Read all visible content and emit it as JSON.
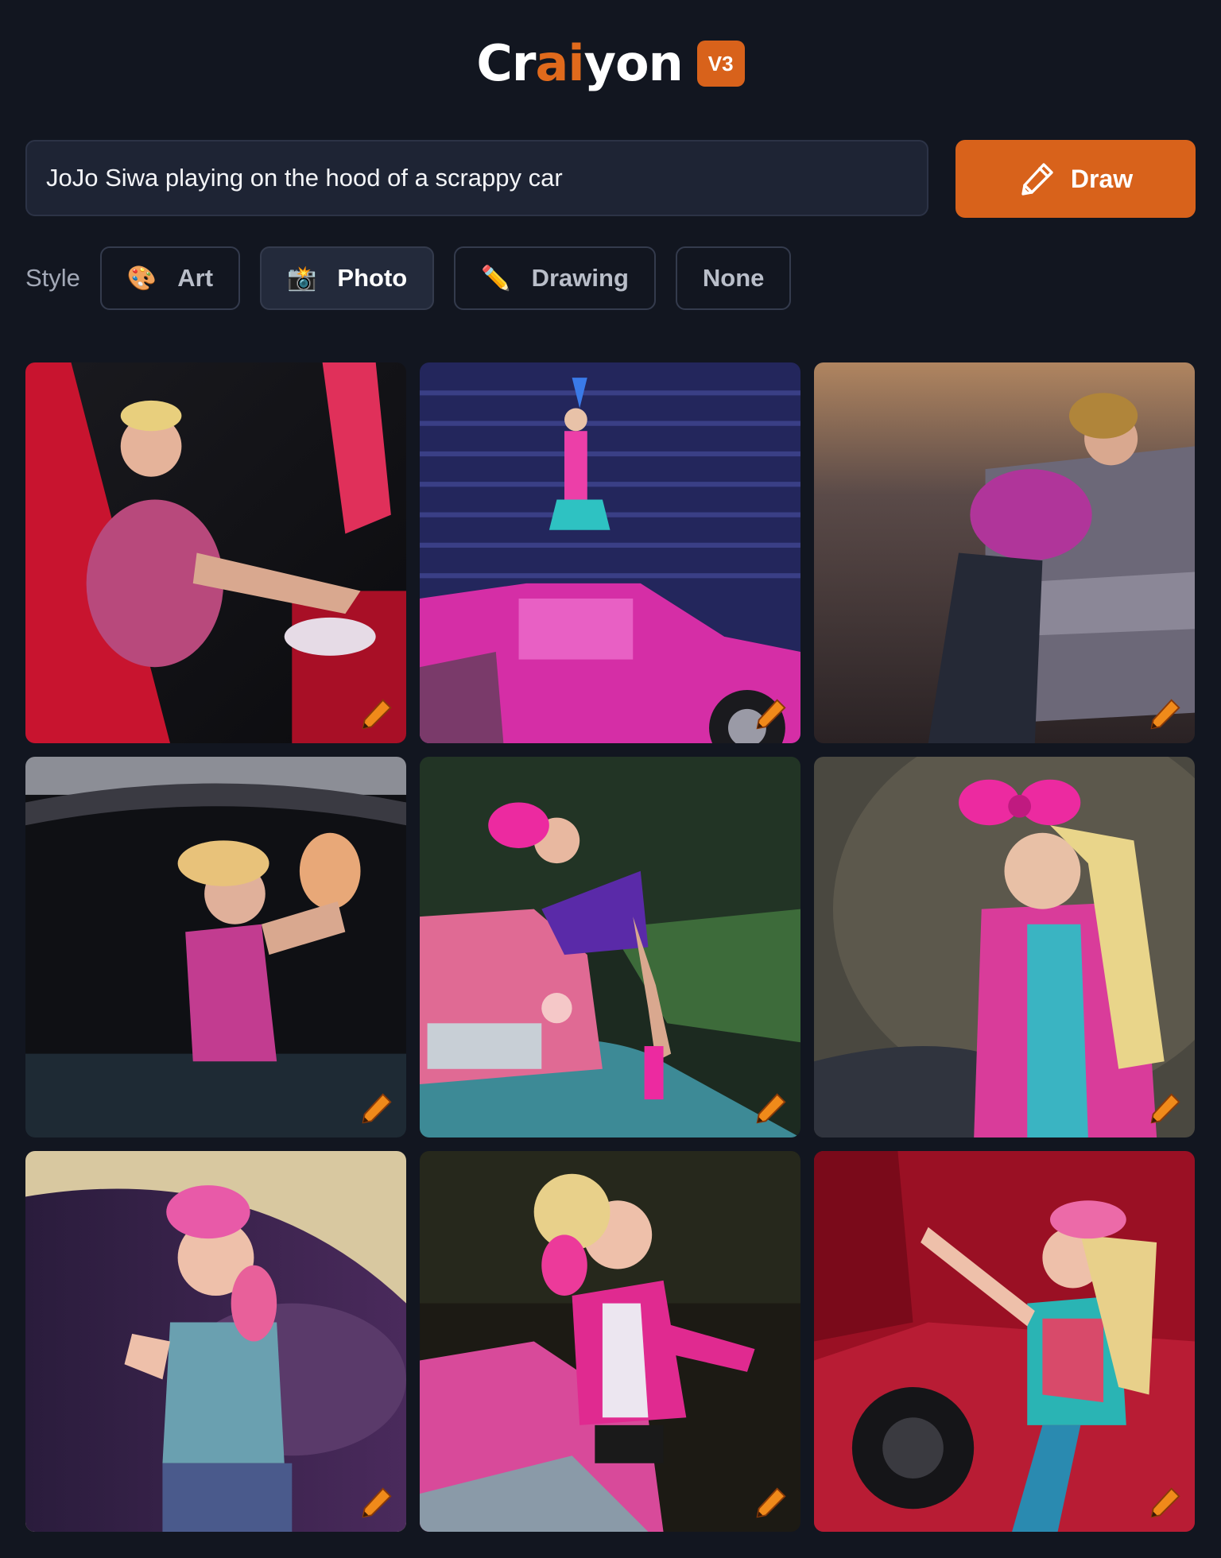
{
  "header": {
    "logo_part1": "Cr",
    "logo_part2": "ai",
    "logo_part3": "yon",
    "version_badge": "V3"
  },
  "prompt": {
    "value": "JoJo Siwa playing on the hood of a scrappy car"
  },
  "draw_button": {
    "label": "Draw",
    "icon": "pencil-icon"
  },
  "style": {
    "label": "Style",
    "options": [
      {
        "label": "Art",
        "emoji": "🎨",
        "selected": false
      },
      {
        "label": "Photo",
        "emoji": "📸",
        "selected": true
      },
      {
        "label": "Drawing",
        "emoji": "✏️",
        "selected": false
      },
      {
        "label": "None",
        "emoji": "",
        "selected": false
      }
    ]
  },
  "colors": {
    "background": "#121620",
    "accent": "#d8621b",
    "input_bg": "#1e2434"
  }
}
